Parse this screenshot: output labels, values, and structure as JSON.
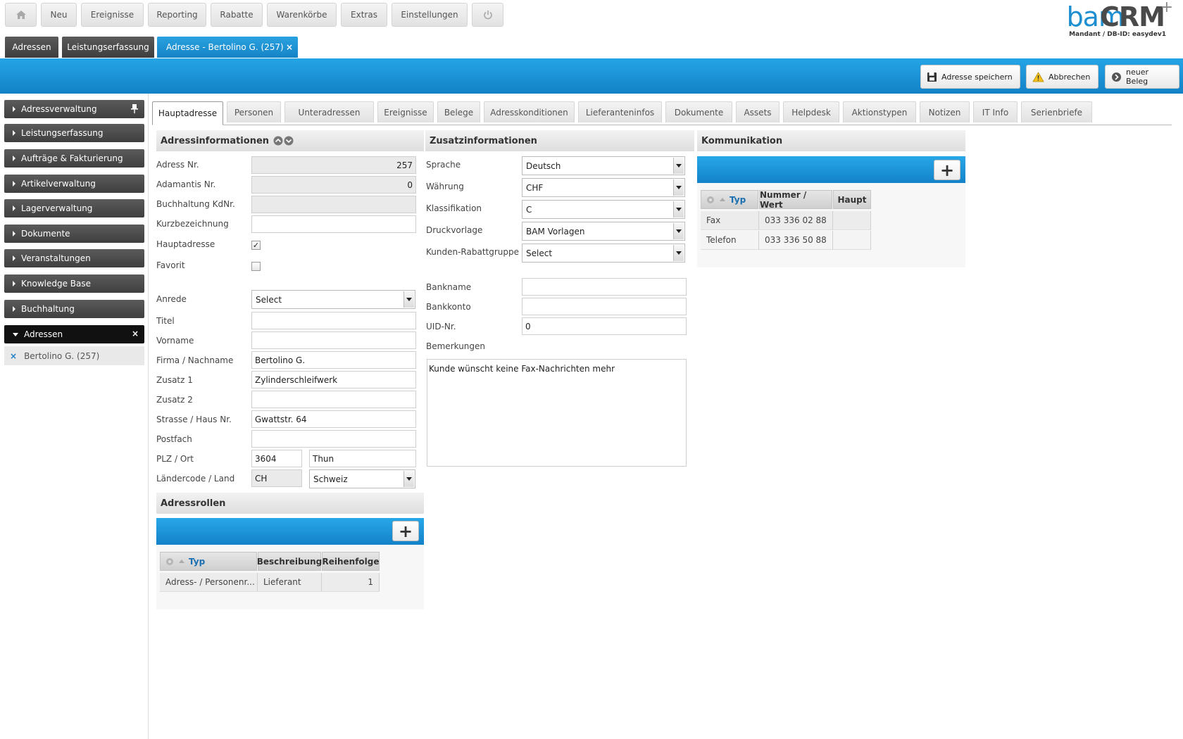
{
  "topnav": {
    "items": [
      "Neu",
      "Ereignisse",
      "Reporting",
      "Rabatte",
      "Warenkörbe",
      "Extras",
      "Einstellungen"
    ],
    "home_icon": "home-icon",
    "power_icon": "power-icon"
  },
  "logo": {
    "bam": "bam",
    "crm": "CRM",
    "plus": "+",
    "mandant": "Mandant / DB-ID: easydev1"
  },
  "doctabs": {
    "items": [
      "Adressen",
      "Leistungserfassung",
      "Adresse - Bertolino G. (257)"
    ],
    "close": "×"
  },
  "toolbar": {
    "save_label": "Adresse speichern",
    "cancel_label": "Abbrechen",
    "new_doc_label": "neuer Beleg"
  },
  "sidebar": {
    "items": [
      "Adressverwaltung",
      "Leistungserfassung",
      "Aufträge & Fakturierung",
      "Artikelverwaltung",
      "Lagerverwaltung",
      "Dokumente",
      "Veranstaltungen",
      "Knowledge Base",
      "Buchhaltung",
      "Adressen"
    ],
    "sub_item": "Bertolino G. (257)",
    "sub_close": "×",
    "close": "×"
  },
  "content_tabs": [
    "Hauptadresse",
    "Personen",
    "Unteradressen",
    "Ereignisse",
    "Belege",
    "Adresskonditionen",
    "Lieferanteninfos",
    "Dokumente",
    "Assets",
    "Helpdesk",
    "Aktionstypen",
    "Notizen",
    "IT Info",
    "Serienbriefe"
  ],
  "adressinfo": {
    "title": "Adressinformationen",
    "labels": {
      "adress_nr": "Adress Nr.",
      "adamantis_nr": "Adamantis Nr.",
      "buchhaltung": "Buchhaltung KdNr.",
      "kurz": "Kurzbezeichnung",
      "hauptadresse": "Hauptadresse",
      "favorit": "Favorit",
      "anrede": "Anrede",
      "titel": "Titel",
      "vorname": "Vorname",
      "firma": "Firma / Nachname",
      "zusatz1": "Zusatz 1",
      "zusatz2": "Zusatz 2",
      "strasse": "Strasse / Haus Nr.",
      "postfach": "Postfach",
      "plz_ort": "PLZ / Ort",
      "land": "Ländercode / Land"
    },
    "values": {
      "adress_nr": "257",
      "adamantis_nr": "0",
      "buchhaltung": "",
      "kurz": "",
      "hauptadresse_checked": "✓",
      "favorit_checked": "",
      "anrede": "Select",
      "titel": "",
      "vorname": "",
      "firma": "Bertolino G.",
      "zusatz1": "Zylinderschleifwerk",
      "zusatz2": "",
      "strasse": "Gwattstr. 64",
      "postfach": "",
      "plz": "3604",
      "ort": "Thun",
      "laendercode": "CH",
      "land": "Schweiz"
    }
  },
  "adressrollen": {
    "title": "Adressrollen",
    "add": "+",
    "columns": [
      "Typ",
      "Beschreibung",
      "Reihenfolge"
    ],
    "rows": [
      [
        "Adress- / Personenr...",
        "Lieferant",
        "1"
      ]
    ]
  },
  "zusatzinfo": {
    "title": "Zusatzinformationen",
    "labels": {
      "sprache": "Sprache",
      "waehrung": "Währung",
      "klassifikation": "Klassifikation",
      "druckvorlage": "Druckvorlage",
      "rabattgruppe": "Kunden-Rabattgruppe",
      "bankname": "Bankname",
      "bankkonto": "Bankkonto",
      "uid": "UID-Nr.",
      "bemerkungen": "Bemerkungen"
    },
    "values": {
      "sprache": "Deutsch",
      "waehrung": "CHF",
      "klassifikation": "C",
      "druckvorlage": "BAM Vorlagen",
      "rabattgruppe": "Select",
      "bankname": "",
      "bankkonto": "",
      "uid": "0",
      "bemerkungen": "Kunde wünscht keine Fax-Nachrichten mehr"
    }
  },
  "kommunikation": {
    "title": "Kommunikation",
    "add": "+",
    "columns": [
      "Typ",
      "Nummer / Wert",
      "Haupt"
    ],
    "rows": [
      [
        "Fax",
        "033 336 02 88",
        ""
      ],
      [
        "Telefon",
        "033 336 50 88",
        ""
      ]
    ]
  },
  "colors": {
    "accent": "#1a8fd4",
    "dark": "#474747",
    "logo_blue": "#1d8fd0"
  }
}
